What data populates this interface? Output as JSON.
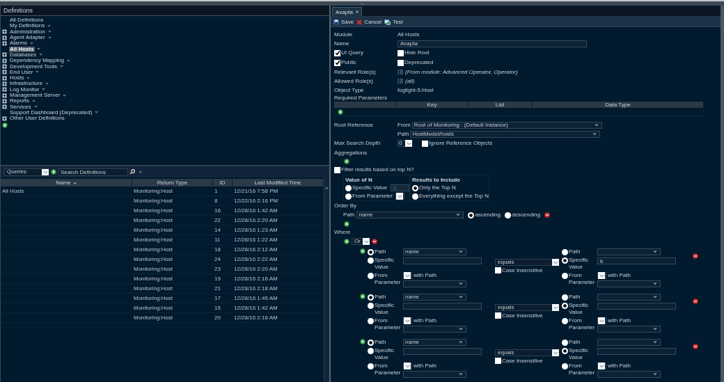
{
  "definitions": {
    "title": "Definitions",
    "tree": [
      {
        "label": "All Definitions",
        "expandable": false,
        "selected": false,
        "menu": false
      },
      {
        "label": "My Definitions",
        "expandable": false,
        "selected": false,
        "menu": true
      },
      {
        "label": "Administration",
        "expandable": true,
        "selected": false,
        "menu": true
      },
      {
        "label": "Agent Adapter",
        "expandable": true,
        "selected": false,
        "menu": true
      },
      {
        "label": "Alarms",
        "expandable": true,
        "selected": false,
        "menu": true
      },
      {
        "label": "All Hosts",
        "expandable": false,
        "selected": true,
        "menu": true
      },
      {
        "label": "Databases",
        "expandable": true,
        "selected": false,
        "menu": true
      },
      {
        "label": "Dependency Mapping",
        "expandable": true,
        "selected": false,
        "menu": true
      },
      {
        "label": "Development Tools",
        "expandable": true,
        "selected": false,
        "menu": true
      },
      {
        "label": "End User",
        "expandable": true,
        "selected": false,
        "menu": true
      },
      {
        "label": "Hosts",
        "expandable": true,
        "selected": false,
        "menu": true
      },
      {
        "label": "Infrastructure",
        "expandable": true,
        "selected": false,
        "menu": true
      },
      {
        "label": "Log Monitor",
        "expandable": true,
        "selected": false,
        "menu": true
      },
      {
        "label": "Management Server",
        "expandable": true,
        "selected": false,
        "menu": true
      },
      {
        "label": "Reports",
        "expandable": true,
        "selected": false,
        "menu": true
      },
      {
        "label": "Services",
        "expandable": true,
        "selected": false,
        "menu": true
      },
      {
        "label": "Support Dashboard (Deprecated)",
        "expandable": false,
        "selected": false,
        "menu": true
      },
      {
        "label": "Other User Definitions",
        "expandable": true,
        "selected": false,
        "menu": false
      }
    ]
  },
  "query_list": {
    "scope": "Queries",
    "search_placeholder": "Search Definitions",
    "columns": [
      {
        "label": "Name",
        "sorted": true
      },
      {
        "label": "Return Type",
        "sorted": false
      },
      {
        "label": "ID",
        "sorted": false
      },
      {
        "label": "Last Modified Time",
        "sorted": false
      }
    ],
    "rows": [
      {
        "name": "All Hosts",
        "return_type": "Monitoring:Host",
        "id": "1",
        "modified": "12/21/16 7:58 PM"
      },
      {
        "return_type": "Monitoring:Host",
        "id": "8",
        "modified": "12/22/16 2:16 PM"
      },
      {
        "return_type": "Monitoring:Host",
        "id": "16",
        "modified": "12/28/16 1:42 AM"
      },
      {
        "return_type": "Monitoring:Host",
        "id": "22",
        "modified": "12/28/16 2:20 AM"
      },
      {
        "return_type": "Monitoring:Host",
        "id": "14",
        "modified": "12/28/16 1:23 AM"
      },
      {
        "return_type": "Monitoring:Host",
        "id": "11",
        "modified": "12/28/16 1:22 AM"
      },
      {
        "return_type": "Monitoring:Host",
        "id": "18",
        "modified": "12/28/16 2:12 AM"
      },
      {
        "return_type": "Monitoring:Host",
        "id": "24",
        "modified": "12/28/16 2:22 AM"
      },
      {
        "return_type": "Monitoring:Host",
        "id": "23",
        "modified": "12/28/16 2:20 AM"
      },
      {
        "return_type": "Monitoring:Host",
        "id": "19",
        "modified": "12/28/16 2:16 AM"
      },
      {
        "return_type": "Monitoring:Host",
        "id": "21",
        "modified": "12/28/16 2:18 AM"
      },
      {
        "return_type": "Monitoring:Host",
        "id": "17",
        "modified": "12/28/16 1:45 AM"
      },
      {
        "return_type": "Monitoring:Host",
        "id": "15",
        "modified": "12/28/16 1:42 AM"
      },
      {
        "return_type": "Monitoring:Host",
        "id": "20",
        "modified": "12/28/16 2:16 AM"
      }
    ]
  },
  "editor": {
    "tabs": [
      {
        "label": "Axapta",
        "selected": true
      }
    ],
    "toolbar": [
      {
        "kind": "save",
        "label": "Save"
      },
      {
        "kind": "cancel",
        "label": "Cancel"
      },
      {
        "kind": "test",
        "label": "Test"
      }
    ],
    "module": {
      "label": "Module",
      "value": "All Hosts"
    },
    "name": {
      "label": "Name",
      "value": "Axapta"
    },
    "flags": [
      [
        {
          "label": "UI Query",
          "checked": true
        },
        {
          "label": "Hide Root",
          "checked": false
        }
      ],
      [
        {
          "label": "Public",
          "checked": true
        },
        {
          "label": "Deprecated",
          "checked": false
        }
      ]
    ],
    "relevant_roles": {
      "label": "Relevant Role(s)",
      "value": "(From module: Advanced Operator, Operator)"
    },
    "allowed_roles": {
      "label": "Allowed Role(s)",
      "value": "(all)"
    },
    "object_type": {
      "label": "Object Type",
      "value": "foglight-5:Host"
    },
    "required_parameters": {
      "label": "Required Parameters",
      "columns": [
        "Key",
        "List",
        "Data Type"
      ]
    },
    "root_reference": {
      "label": "Root Reference",
      "from_label": "From",
      "from": "Root of Monitoring : (Default Instance)",
      "path_label": "Path",
      "path": "HostModel/hosts"
    },
    "max_search_depth": {
      "label": "Max Search Depth",
      "value": "0",
      "ignore_label": "Ignore Reference Objects",
      "ignore_checked": false
    },
    "aggregations": {
      "label": "Aggregations"
    },
    "top_n": {
      "label": "Filter results based on top N?",
      "checked": false,
      "value_title": "Value of N",
      "value_options": [
        {
          "label": "Specific Value",
          "selected": false
        },
        {
          "label": "From Parameter",
          "selected": false
        }
      ],
      "value": "0",
      "include_title": "Results to Include",
      "include_options": [
        {
          "label": "Only the Top N",
          "selected": true
        },
        {
          "label": "Everything except the Top N",
          "selected": false
        }
      ]
    },
    "order_by": {
      "label": "Order By",
      "path_label": "Path",
      "path": "name",
      "directions": [
        {
          "label": "ascending",
          "selected": true
        },
        {
          "label": "descending",
          "selected": false
        }
      ]
    },
    "where": {
      "label": "Where",
      "combinator": "Or",
      "conditions": [
        {
          "left": {
            "options": [
              {
                "label": "Path",
                "selected": true
              },
              {
                "label": "Specific Value",
                "selected": false
              },
              {
                "label": "From Parameter",
                "selected": false
              }
            ],
            "path": "name",
            "with_path": "with Path"
          },
          "operator": "equals",
          "case_insensitive": false,
          "case_label": "Case Insensitive",
          "right": {
            "options": [
              {
                "label": "Path",
                "selected": false
              },
              {
                "label": "Specific Value",
                "selected": true
              },
              {
                "label": "From Parameter",
                "selected": false
              }
            ],
            "value": "b",
            "with_path": "with Path"
          }
        },
        {
          "left": {
            "options": [
              {
                "label": "Path",
                "selected": true
              },
              {
                "label": "Specific Value",
                "selected": false
              },
              {
                "label": "From Parameter",
                "selected": false
              }
            ],
            "path": "name",
            "with_path": "with Path"
          },
          "operator": "equals",
          "case_insensitive": false,
          "case_label": "Case Insensitive",
          "right": {
            "options": [
              {
                "label": "Path",
                "selected": false
              },
              {
                "label": "Specific Value",
                "selected": true
              },
              {
                "label": "From Parameter",
                "selected": false
              }
            ],
            "with_path": "with Path"
          }
        },
        {
          "left": {
            "options": [
              {
                "label": "Path",
                "selected": true
              },
              {
                "label": "Specific Value",
                "selected": false
              },
              {
                "label": "From Parameter",
                "selected": false
              }
            ],
            "path": "name",
            "with_path": "with Path"
          },
          "operator": "equals",
          "case_insensitive": false,
          "case_label": "Case Insensitive",
          "right": {
            "options": [
              {
                "label": "Path",
                "selected": false
              },
              {
                "label": "Specific Value",
                "selected": true
              },
              {
                "label": "From Parameter",
                "selected": false
              }
            ],
            "with_path": "with Path"
          }
        }
      ]
    }
  }
}
